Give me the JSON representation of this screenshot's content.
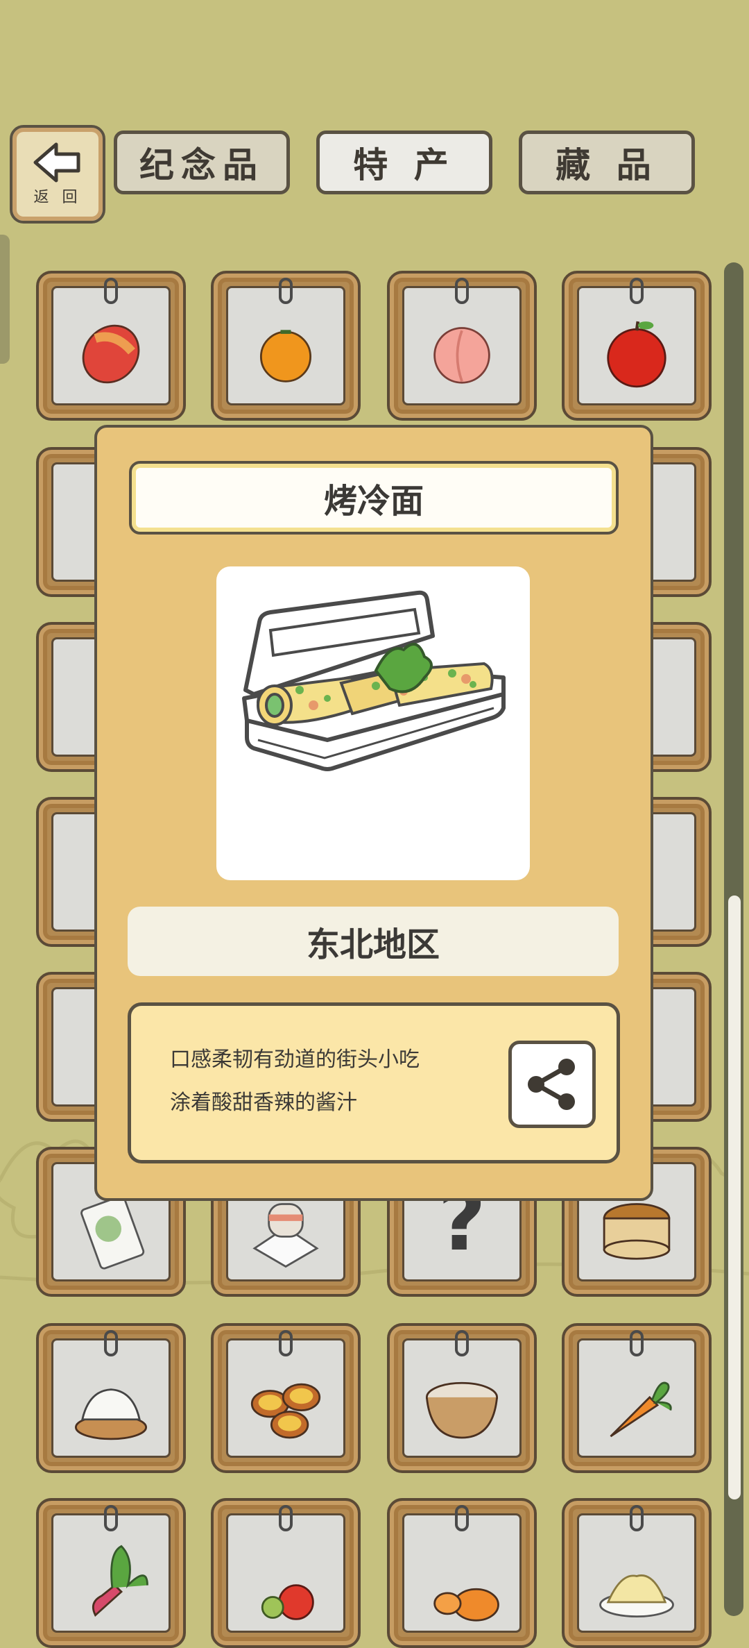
{
  "header": {
    "back_label": "返 回",
    "tabs": [
      {
        "label": "纪念品",
        "active": false
      },
      {
        "label": "特 产",
        "active": true
      },
      {
        "label": "藏 品",
        "active": false
      }
    ]
  },
  "grid": {
    "items": [
      {
        "icon": "mango-icon"
      },
      {
        "icon": "orange-icon"
      },
      {
        "icon": "peach-icon"
      },
      {
        "icon": "apple-icon"
      },
      {
        "icon": "partial-item-icon"
      },
      {
        "icon": "partial-item-icon"
      },
      {
        "icon": "partial-item-icon"
      },
      {
        "icon": "partial-item-icon"
      },
      {
        "icon": "partial-item-icon"
      },
      {
        "icon": "partial-item-icon"
      },
      {
        "icon": "partial-item-icon"
      },
      {
        "icon": "partial-item-icon"
      },
      {
        "icon": "partial-item-icon"
      },
      {
        "icon": "partial-item-icon"
      },
      {
        "icon": "partial-item-icon"
      },
      {
        "icon": "partial-item-icon"
      },
      {
        "icon": "partial-item-icon"
      },
      {
        "icon": "partial-item-icon"
      },
      {
        "icon": "partial-item-icon"
      },
      {
        "icon": "partial-item-icon"
      },
      {
        "icon": "snack-bag-icon"
      },
      {
        "icon": "mooncake-plate-icon"
      },
      {
        "icon": "unknown-item-icon",
        "text": "?"
      },
      {
        "icon": "rice-bucket-icon"
      },
      {
        "icon": "dumplings-icon"
      },
      {
        "icon": "egg-tarts-icon"
      },
      {
        "icon": "porridge-bowl-icon"
      },
      {
        "icon": "carrot-icon"
      },
      {
        "icon": "radish-icon"
      },
      {
        "icon": "tomatoes-icon"
      },
      {
        "icon": "pumpkins-icon"
      },
      {
        "icon": "noodle-dish-icon"
      }
    ]
  },
  "modal": {
    "title": "烤冷面",
    "image_icon": "grilled-cold-noodles-box-icon",
    "region": "东北地区",
    "description": [
      "口感柔韧有劲道的街头小吃",
      "涂着酸甜香辣的酱汁"
    ],
    "share_icon": "share-icon"
  },
  "colors": {
    "background": "#c6c17f",
    "modal": "#e8c47b",
    "frame": "#b38a52"
  }
}
